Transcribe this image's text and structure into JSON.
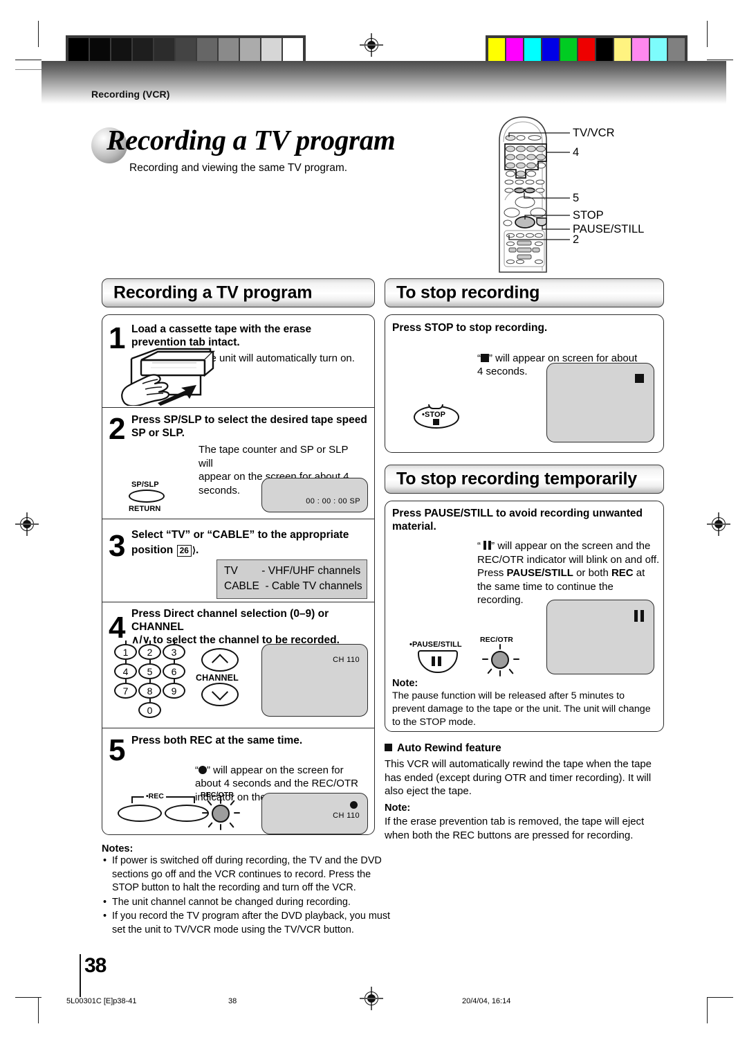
{
  "running_head": "Recording (VCR)",
  "title": {
    "main": "Recording a TV program",
    "sub": "Recording and viewing the same TV program."
  },
  "remote_callouts": [
    {
      "label": "TV/VCR"
    },
    {
      "label": "4"
    },
    {
      "label": "5"
    },
    {
      "label": "STOP"
    },
    {
      "label": "PAUSE/STILL"
    },
    {
      "label": "2"
    }
  ],
  "left_column": {
    "section_title": "Recording a TV program",
    "steps": [
      {
        "number": "1",
        "heading": "Load a cassette tape with the erase\nprevention tab intact.",
        "body": "The unit will automatically turn on."
      },
      {
        "number": "2",
        "heading": "Press SP/SLP to select the desired tape speed\nSP or SLP.",
        "body": "The tape counter and SP or SLP will\nappear on the screen for about 4\nseconds.",
        "button_top": "SP/SLP",
        "button_bottom": "RETURN",
        "screen_osd": "00 : 00 : 00   SP"
      },
      {
        "number": "3",
        "heading_part1": "Select “TV” or “CABLE” to the appropriate",
        "heading_part2": "position",
        "page_ref": "26",
        "heading_part3": ".",
        "table": "TV        - VHF/UHF channels\nCABLE  - Cable TV channels"
      },
      {
        "number": "4",
        "heading": "Press Direct channel selection (0–9) or CHANNEL\n∧/∨ to select the channel to be recorded.",
        "keypad": [
          "1",
          "2",
          "3",
          "4",
          "5",
          "6",
          "7",
          "8",
          "9",
          "0"
        ],
        "channel_label": "CHANNEL",
        "screen_osd": "CH  110"
      },
      {
        "number": "5",
        "heading": "Press both REC at the same time.",
        "body_prefix": "“",
        "body_suffix": "” will appear on the screen for\nabout 4 seconds and the REC/OTR\nindicator on the front panel will light.",
        "rec_label": "•REC",
        "lamp_label": "REC/OTR",
        "screen_osd": "CH  110"
      }
    ],
    "notes_heading": "Notes:",
    "notes": [
      "If power is switched off during recording, the TV and the DVD sections go off and the VCR continues to record. Press the STOP button to halt the recording and turn off the VCR.",
      "The unit channel cannot be changed during recording.",
      "If you record the TV program after the DVD playback, you must set the unit to TV/VCR mode using the TV/VCR button."
    ]
  },
  "right_column": {
    "stop_section": {
      "title": "To stop recording",
      "heading": "Press STOP to stop recording.",
      "body_prefix": "“",
      "body_suffix": "” will appear on screen for about\n4 seconds.",
      "button_label": "•STOP"
    },
    "pause_section": {
      "title": "To stop recording temporarily",
      "heading": "Press PAUSE/STILL to avoid recording unwanted\nmaterial.",
      "body_lines": [
        {
          "text": "“ ",
          "bold": false
        },
        {
          "text": "” will appear on the screen and",
          "bold": false
        }
      ],
      "body_rest": "the REC/OTR indicator will blink on\nand off. Press ",
      "bold1": "PAUSE/STILL",
      "body_rest2": " or\nboth ",
      "bold2": "REC",
      "body_rest3": " at the same time to\ncontinue the recording.",
      "button_label": "•PAUSE/STILL",
      "lamp_label": "REC/OTR",
      "note_heading": "Note:",
      "note_text": "The pause function will be released after 5 minutes to prevent damage to the tape or the unit. The unit will change to the STOP mode."
    },
    "auto_rewind": {
      "heading": "Auto Rewind feature",
      "body": "This VCR will automatically rewind the tape when the tape has ended (except during OTR and timer recording). It will also eject the tape.",
      "note_heading": "Note:",
      "note_text": "If the erase prevention tab is removed, the tape will eject when both the REC buttons are pressed for recording."
    }
  },
  "footer": {
    "page_number": "38",
    "file_id": "5L00301C [E]p38-41",
    "center_number": "38",
    "timestamp": "20/4/04, 16:14"
  },
  "colors": {
    "gray_ramp": [
      "#000000",
      "#080808",
      "#121212",
      "#1e1e1e",
      "#2c2c2c",
      "#444444",
      "#666666",
      "#8a8a8a",
      "#ababab",
      "#d6d6d6",
      "#ffffff"
    ],
    "color_ramp": [
      "#ffff00",
      "#ff00ff",
      "#00ffff",
      "#0000e6",
      "#00cc22",
      "#ee0000",
      "#000000",
      "#fff380",
      "#ff88ee",
      "#7dfcfc",
      "#808080"
    ]
  }
}
